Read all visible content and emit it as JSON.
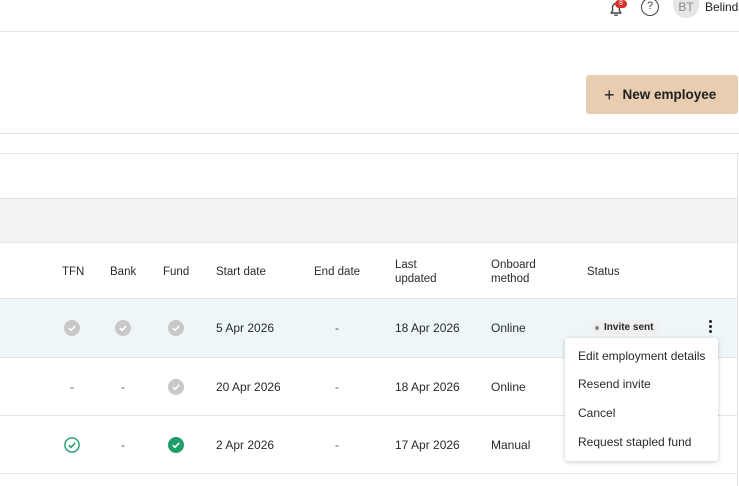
{
  "header": {
    "notification_count": "8",
    "help_label": "?",
    "user_initials": "BT",
    "user_name": "Belinda"
  },
  "actions": {
    "new_employee_label": "New employee"
  },
  "table": {
    "columns": {
      "tfn": "TFN",
      "bank": "Bank",
      "fund": "Fund",
      "start_date": "Start date",
      "end_date": "End date",
      "last_updated": "Last updated",
      "onboard_method": "Onboard method",
      "status": "Status"
    },
    "rows": [
      {
        "tfn": "pending",
        "bank": "pending",
        "fund": "pending",
        "start_date": "5 Apr 2026",
        "end_date": "-",
        "last_updated": "18 Apr 2026",
        "onboard_method": "Online",
        "status": "Invite sent"
      },
      {
        "tfn": "-",
        "bank": "-",
        "fund": "pending",
        "start_date": "20 Apr 2026",
        "end_date": "-",
        "last_updated": "18 Apr 2026",
        "onboard_method": "Online",
        "status": ""
      },
      {
        "tfn": "complete-outline",
        "bank": "-",
        "fund": "complete-filled",
        "start_date": "2 Apr 2026",
        "end_date": "-",
        "last_updated": "17 Apr 2026",
        "onboard_method": "Manual",
        "status": ""
      }
    ]
  },
  "row_menu": {
    "items": [
      "Edit employment details",
      "Resend invite",
      "Cancel",
      "Request stapled fund"
    ]
  },
  "colors": {
    "primary_button": "#e8cdb0",
    "success": "#1e9e6a",
    "pending": "#c8c8c8",
    "selected_row": "#eef6f9",
    "notification": "#d6302b"
  }
}
